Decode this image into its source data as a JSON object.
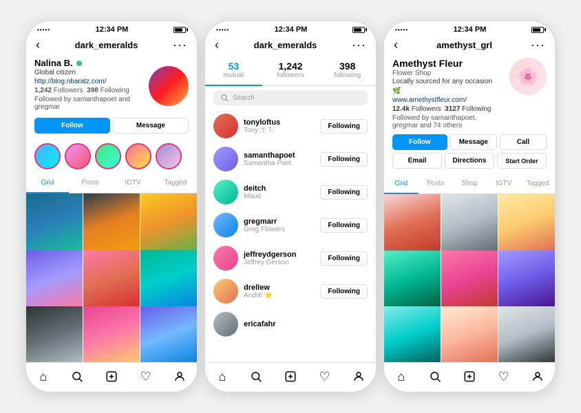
{
  "phones": [
    {
      "id": "phone1",
      "statusBar": {
        "dots": "•••••",
        "time": "12:34 PM",
        "signal": "▊▊▊"
      },
      "nav": {
        "back": "‹",
        "title": "dark_emeralds",
        "more": "···"
      },
      "profile": {
        "name": "Nalina B.",
        "badge": "🌿",
        "bio": "Global citizen",
        "link": "http://blog.nbaratz.com/",
        "followers": "1,242",
        "following": "398",
        "followedBy": "Followed by samanthapoet and gregmar"
      },
      "buttons": {
        "follow": "Follow",
        "message": "Message"
      },
      "tabs": [
        "Grid",
        "Posts",
        "IGTV",
        "Tagged"
      ],
      "activeTab": 0,
      "gridColors": [
        "g1",
        "g2",
        "g3",
        "g4",
        "g5",
        "g6",
        "g7",
        "g8",
        "g9"
      ]
    },
    {
      "id": "phone2",
      "statusBar": {
        "dots": "•••••",
        "time": "12:34 PM",
        "signal": "▊▊▊"
      },
      "nav": {
        "back": "‹",
        "title": "dark_emeralds",
        "more": "···"
      },
      "stats": {
        "mutual": "53",
        "mutualLabel": "mutual",
        "followers": "1,242",
        "followersLabel": "followers",
        "following": "398",
        "followingLabel": "following"
      },
      "searchPlaceholder": "Search",
      "followers": [
        {
          "username": "tonyloftus",
          "name": "Tony 🇹 T.",
          "avatarClass": "fa1"
        },
        {
          "username": "samanthapoet",
          "name": "Samantha Poet",
          "avatarClass": "fa2"
        },
        {
          "username": "deitch",
          "name": "Maud",
          "avatarClass": "fa3"
        },
        {
          "username": "gregmarr",
          "name": "Greg Flowers",
          "avatarClass": "fa4"
        },
        {
          "username": "jeffreydgerson",
          "name": "Jeffrey Gerson",
          "avatarClass": "fa5"
        },
        {
          "username": "drellew",
          "name": "André ⭐",
          "avatarClass": "fa6"
        },
        {
          "username": "ericafahr",
          "name": "",
          "avatarClass": "fa7"
        }
      ],
      "followingLabel": "Following"
    },
    {
      "id": "phone3",
      "statusBar": {
        "dots": "•••••",
        "time": "12:34 PM",
        "signal": "▊▊▊"
      },
      "nav": {
        "back": "‹",
        "title": "amethyst_grl",
        "more": "···"
      },
      "biz": {
        "name": "Amethyst Fleur",
        "type": "Flower Shop",
        "bio": "Locally sourced for any occasion 🌿",
        "link": "www.amethystfleur.com/",
        "followers": "12.4k",
        "following": "3127",
        "followedBy": "Followed by samanthapoet, gregmar and 74 others"
      },
      "buttons": {
        "follow": "Follow",
        "message": "Message",
        "call": "Call",
        "email": "Email",
        "directions": "Directions",
        "startOrder": "Start Order"
      },
      "tabs": [
        "Grid",
        "Posts",
        "Shop",
        "IGTV",
        "Tagged"
      ],
      "activeTab": 0,
      "gridColors": [
        "fg1",
        "fg2",
        "fg3",
        "fg4",
        "fg5",
        "fg6",
        "fg7",
        "fg8",
        "fg9"
      ]
    }
  ],
  "bottomNav": {
    "home": "⌂",
    "search": "🔍",
    "add": "⊕",
    "heart": "♡",
    "profile": "👤"
  }
}
